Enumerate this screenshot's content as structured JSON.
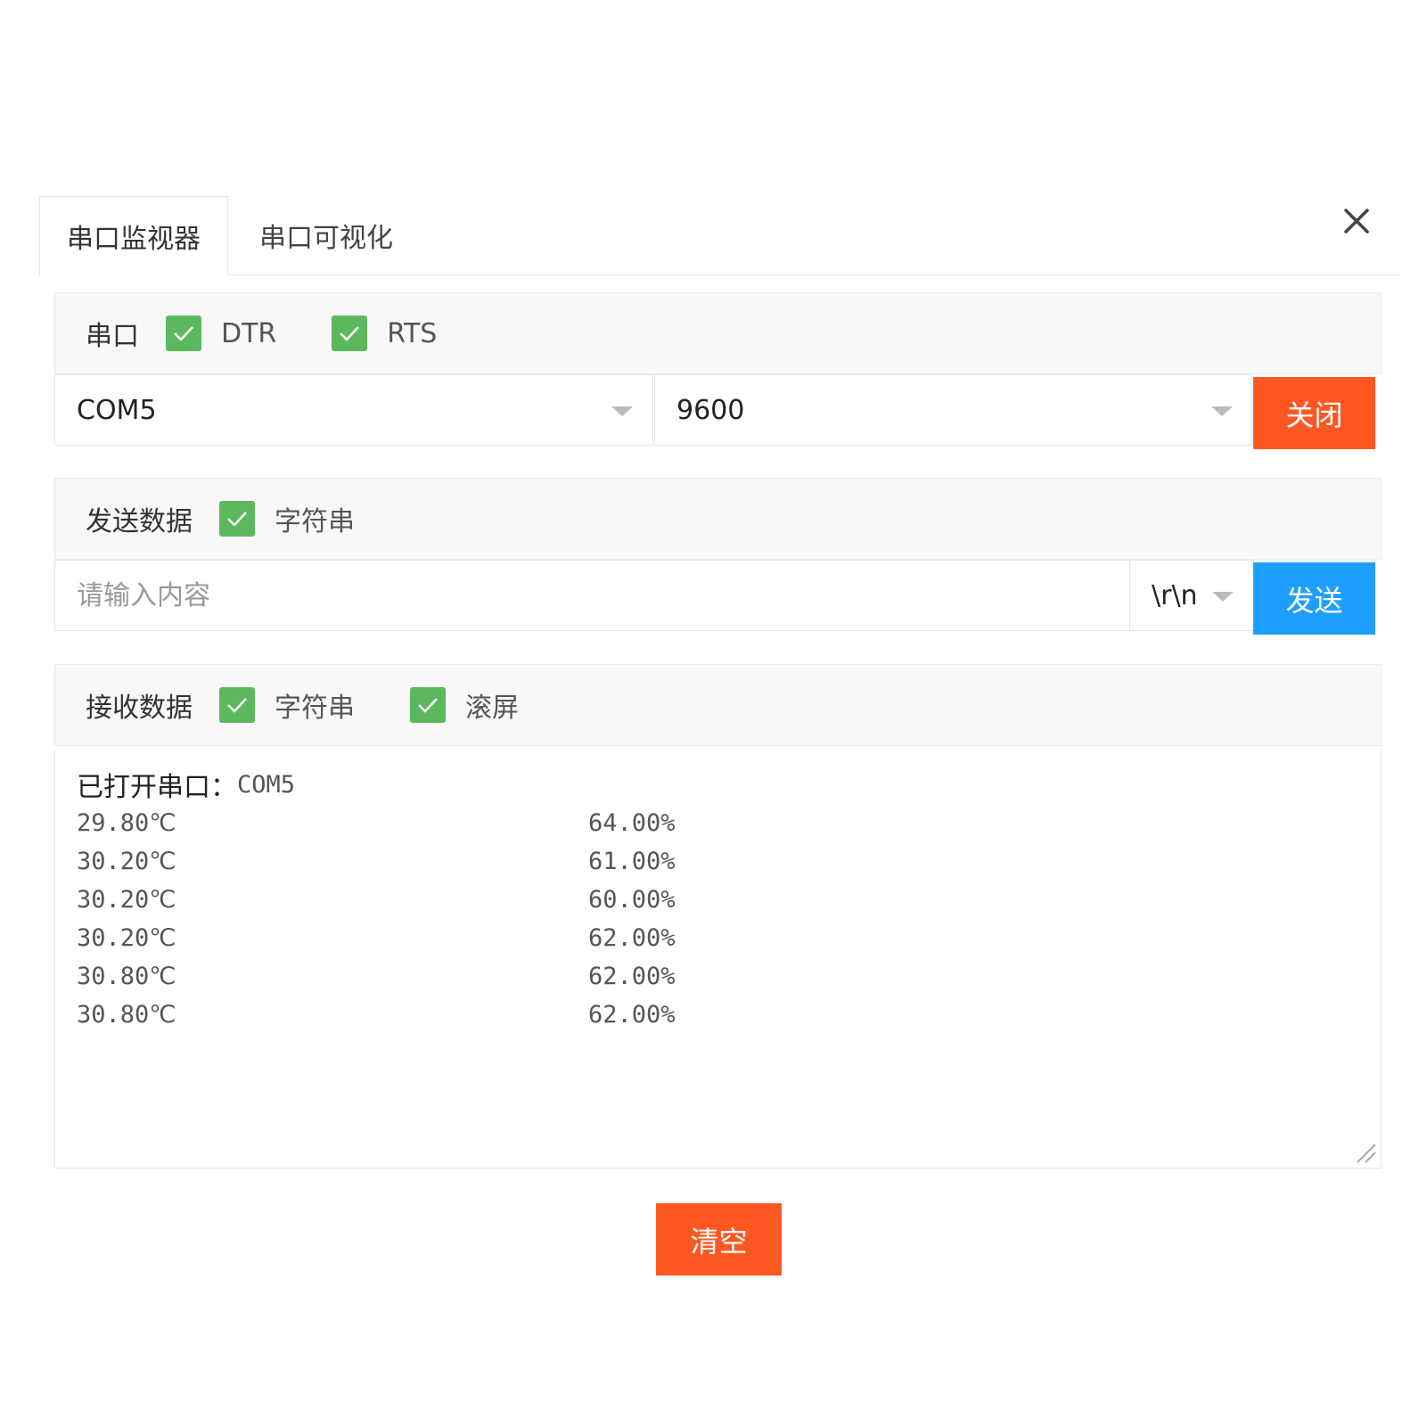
{
  "tabs": [
    {
      "label": "串口监视器",
      "active": true
    },
    {
      "label": "串口可视化",
      "active": false
    }
  ],
  "serial": {
    "label": "串口",
    "dtr_label": "DTR",
    "rts_label": "RTS",
    "port": "COM5",
    "baud": "9600",
    "close_label": "关闭"
  },
  "send": {
    "label": "发送数据",
    "string_label": "字符串",
    "placeholder": "请输入内容",
    "line_ending": "\\r\\n",
    "send_label": "发送"
  },
  "receive": {
    "label": "接收数据",
    "string_label": "字符串",
    "scroll_label": "滚屏",
    "opened_label": "已打开串口：",
    "opened_port": "COM5",
    "rows": [
      {
        "temp": "29.80℃",
        "hum": "64.00%"
      },
      {
        "temp": "30.20℃",
        "hum": "61.00%"
      },
      {
        "temp": "30.20℃",
        "hum": "60.00%"
      },
      {
        "temp": "30.20℃",
        "hum": "62.00%"
      },
      {
        "temp": "30.80℃",
        "hum": "62.00%"
      },
      {
        "temp": "30.80℃",
        "hum": "62.00%"
      }
    ],
    "clear_label": "清空"
  },
  "colors": {
    "check_green": "#5cb85c",
    "orange": "#ff5722",
    "blue": "#1e9fff"
  }
}
